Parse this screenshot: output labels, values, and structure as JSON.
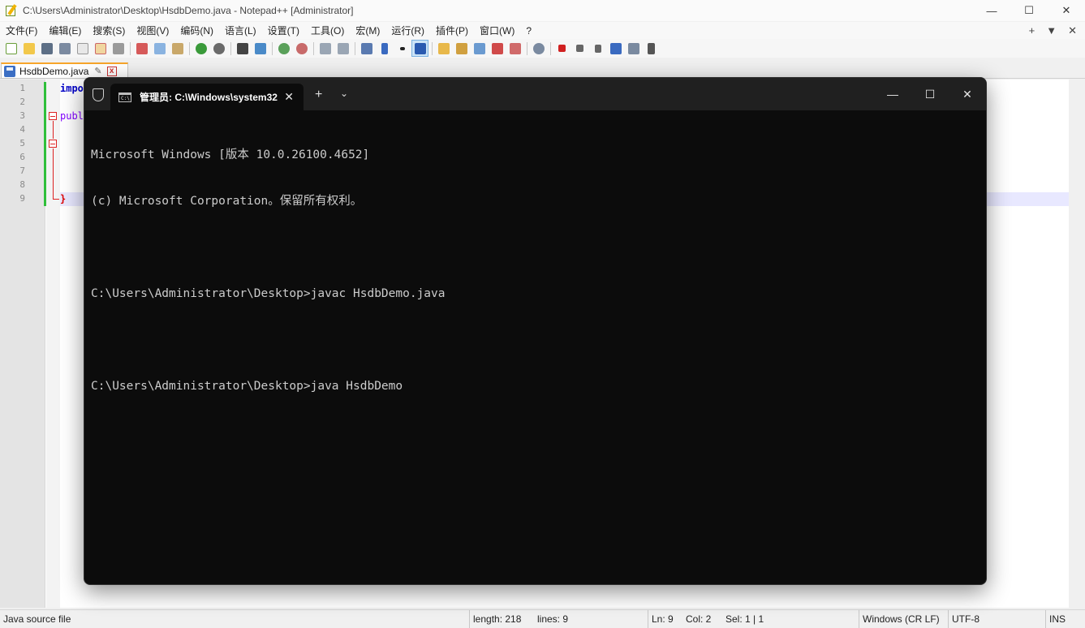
{
  "npp": {
    "title": "C:\\Users\\Administrator\\Desktop\\HsdbDemo.java - Notepad++ [Administrator]",
    "menu": [
      "文件(F)",
      "编辑(E)",
      "搜索(S)",
      "视图(V)",
      "编码(N)",
      "语言(L)",
      "设置(T)",
      "工具(O)",
      "宏(M)",
      "运行(R)",
      "插件(P)",
      "窗口(W)",
      "?"
    ],
    "menu_right": {
      "plus": "+",
      "down": "▼",
      "close": "✕"
    },
    "win": {
      "minimize": "—",
      "maximize": "☐",
      "close": "✕"
    },
    "tab": {
      "label": "HsdbDemo.java",
      "pin": "✎",
      "close": "x"
    },
    "line_numbers": [
      "1",
      "2",
      "3",
      "4",
      "5",
      "6",
      "7",
      "8",
      "9"
    ],
    "code_fragments": {
      "line1": "impo",
      "line3": "publ",
      "line9": "}"
    },
    "status": {
      "filetype": "Java source file",
      "length": "length: 218",
      "lines": "lines: 9",
      "ln": "Ln: 9",
      "col": "Col: 2",
      "sel": "Sel: 1 | 1",
      "eol": "Windows (CR LF)",
      "encoding": "UTF-8",
      "mode": "INS"
    }
  },
  "terminal": {
    "tab_title": "管理员: C:\\Windows\\system32",
    "new_tab": "+",
    "dropdown": "⌄",
    "tab_close": "✕",
    "win": {
      "minimize": "—",
      "maximize": "☐",
      "close": "✕"
    },
    "lines": [
      "Microsoft Windows [版本 10.0.26100.4652]",
      "(c) Microsoft Corporation。保留所有权利。",
      "",
      "C:\\Users\\Administrator\\Desktop>javac HsdbDemo.java",
      "",
      "C:\\Users\\Administrator\\Desktop>java HsdbDemo"
    ]
  },
  "colors": {
    "terminal_bg": "#0c0c0c",
    "terminal_titlebar": "#202020",
    "tab_accent": "#f7a52b",
    "change_bar": "#2fbf3a",
    "keyword": "#0000c8"
  }
}
